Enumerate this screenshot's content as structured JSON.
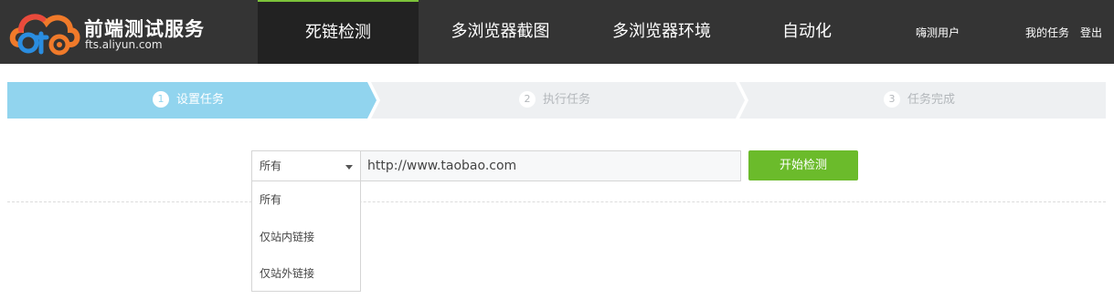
{
  "brand": {
    "title": "前端测试服务",
    "subtitle": "fts.aliyun.com",
    "logo_icon": "cloud-cts-logo",
    "colors": {
      "blue": "#2a8de0",
      "orange": "#f07a2a",
      "red": "#e94a3c"
    }
  },
  "nav": {
    "tabs": [
      {
        "label": "死链检测",
        "active": true
      },
      {
        "label": "多浏览器截图",
        "active": false
      },
      {
        "label": "多浏览器环境",
        "active": false
      },
      {
        "label": "自动化",
        "active": false
      }
    ],
    "user": "嗨测用户",
    "my_tasks": "我的任务",
    "logout": "登出"
  },
  "steps": [
    {
      "num": "1",
      "label": "设置任务",
      "active": true
    },
    {
      "num": "2",
      "label": "执行任务",
      "active": false
    },
    {
      "num": "3",
      "label": "任务完成",
      "active": false
    }
  ],
  "form": {
    "scope_selected": "所有",
    "url_value": "http://www.taobao.com",
    "start_label": "开始检测",
    "scope_options": [
      "所有",
      "仅站内链接",
      "仅站外链接"
    ]
  },
  "colors": {
    "navbar": "#343434",
    "active_tab": "#222222",
    "step_active": "#91d4ee",
    "step_inactive": "#eef0f2",
    "button": "#6bbb2b"
  }
}
